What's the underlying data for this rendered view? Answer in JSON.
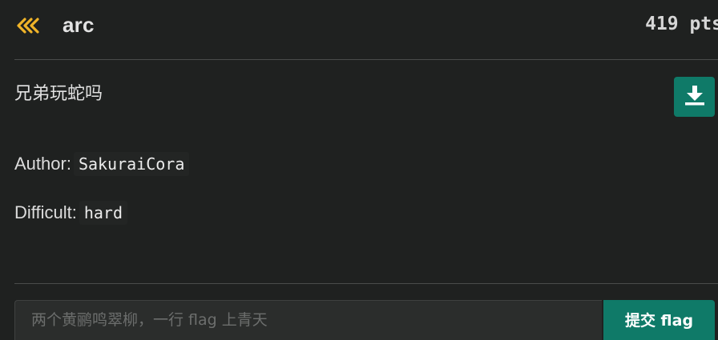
{
  "header": {
    "back_icon": "triple-chevron-left-icon",
    "title": "arc",
    "points": "419 pts"
  },
  "challenge": {
    "description": "兄弟玩蛇吗",
    "download_icon": "download-icon",
    "author_label": "Author:",
    "author_value": "SakuraiCora",
    "difficulty_label": "Difficult:",
    "difficulty_value": "hard"
  },
  "flag_form": {
    "placeholder": "两个黄鹂鸣翠柳，一行 flag 上青天",
    "value": "",
    "submit_label": "提交 flag"
  },
  "colors": {
    "background": "#1f2120",
    "accent_yellow": "#f0b429",
    "accent_teal": "#0f7a68",
    "text": "#e3e3e3"
  }
}
